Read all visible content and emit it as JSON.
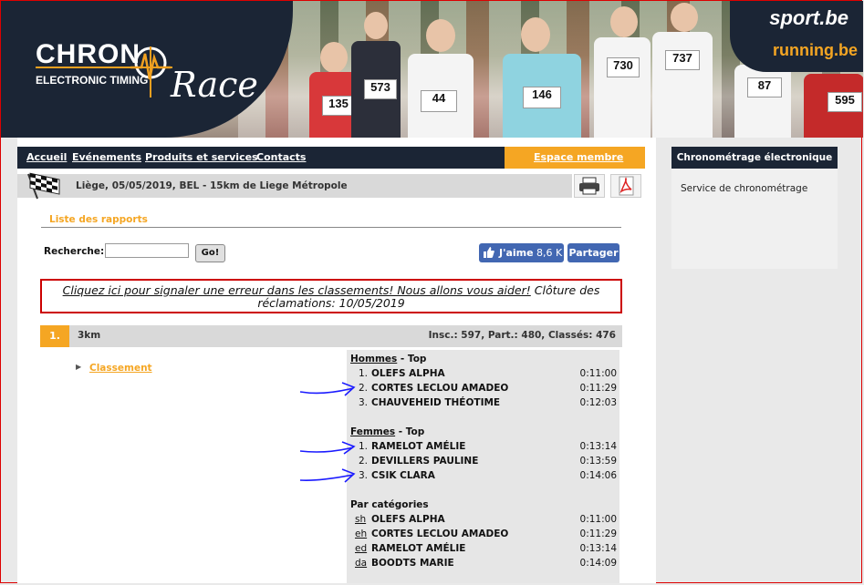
{
  "header": {
    "logo_chrono": "CHRON",
    "logo_subtitle": "ELECTRONIC TIMING",
    "logo_race": "Race",
    "sport_logo": "sport.be",
    "running_logo": "running.be",
    "bibs": [
      "135",
      "44",
      "146",
      "573",
      "730",
      "737",
      "87",
      "595"
    ]
  },
  "nav": {
    "items": [
      "Accueil",
      "Evénements",
      "Produits et services",
      "Contacts"
    ],
    "member_label": "Espace membre"
  },
  "event": {
    "title": "Liège, 05/05/2019, BEL - 15km de Liege Métropole"
  },
  "reports": {
    "label": "Liste des rapports"
  },
  "search": {
    "label": "Recherche:",
    "value": "",
    "go_label": "Go!"
  },
  "facebook": {
    "like_label": "J'aime",
    "like_count": "8,6 K",
    "share_label": "Partager"
  },
  "notice": {
    "link_text": "Cliquez ici pour signaler une erreur dans les classements! Nous allons vous aider!",
    "closing_text": "Clôture des réclamations: 10/05/2019"
  },
  "race": {
    "number": "1.",
    "name": "3km",
    "stats": "Insc.: 597, Part.: 480, Classés: 476",
    "classement_label": "Classement",
    "men": {
      "title": "Hommes",
      "suffix": " - Top",
      "rows": [
        {
          "rank": "1.",
          "name": "OLEFS ALPHA",
          "time": "0:11:00"
        },
        {
          "rank": "2.",
          "name": "CORTES LECLOU AMADEO",
          "time": "0:11:29"
        },
        {
          "rank": "3.",
          "name": "CHAUVEHEID THÉOTIME",
          "time": "0:12:03"
        }
      ]
    },
    "women": {
      "title": "Femmes",
      "suffix": " - Top",
      "rows": [
        {
          "rank": "1.",
          "name": "RAMELOT AMÉLIE",
          "time": "0:13:14"
        },
        {
          "rank": "2.",
          "name": "DEVILLERS PAULINE",
          "time": "0:13:59"
        },
        {
          "rank": "3.",
          "name": "CSIK CLARA",
          "time": "0:14:06"
        }
      ]
    },
    "categories": {
      "title": "Par catégories",
      "rows": [
        {
          "cat": "sh",
          "name": "OLEFS ALPHA",
          "time": "0:11:00"
        },
        {
          "cat": "eh",
          "name": "CORTES LECLOU AMADEO",
          "time": "0:11:29"
        },
        {
          "cat": "ed",
          "name": "RAMELOT AMÉLIE",
          "time": "0:13:14"
        },
        {
          "cat": "da",
          "name": "BOODTS MARIE",
          "time": "0:14:09"
        }
      ]
    }
  },
  "sidebar": {
    "title": "Chronométrage électronique",
    "item": "Service de chronométrage"
  },
  "colors": {
    "accent": "#f5a623",
    "navy": "#1b2535",
    "facebook": "#4267b2",
    "annotation": "#1a1aff"
  }
}
